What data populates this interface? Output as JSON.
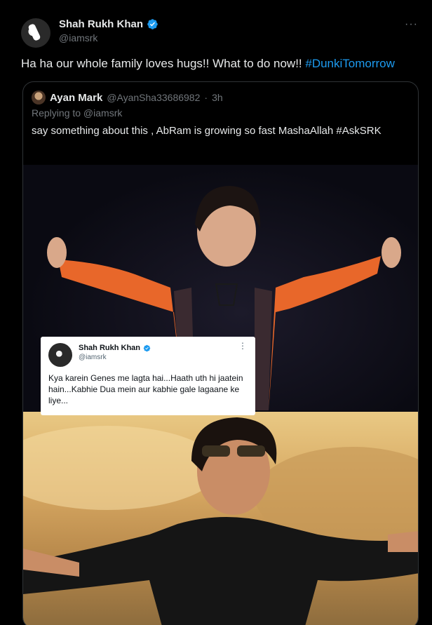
{
  "author": {
    "name": "Shah Rukh Khan",
    "handle": "@iamsrk",
    "more_icon": "more-horizontal-icon",
    "verified_color": "#1d9bf0"
  },
  "tweet": {
    "text": "Ha ha our whole family loves hugs!! What to do now!! ",
    "hashtag": "#DunkiTomorrow"
  },
  "quote": {
    "name": "Ayan Mark",
    "handle": "@AyanSha33686982",
    "separator": "·",
    "time": "3h",
    "replying_to": "Replying to @iamsrk",
    "text": "say something about this , AbRam is growing so fast MashaAllah #AskSRK"
  },
  "media": {
    "inner_tweet": {
      "name": "Shah Rukh Khan",
      "handle": "@iamsrk",
      "text": "Kya karein Genes me lagta hai...Haath uth hi jaatein hain...Kabhie Dua mein aur kabhie gale lagaane ke liye..."
    }
  },
  "colors": {
    "background": "#000000",
    "text": "#e7e9ea",
    "muted": "#71767b",
    "link": "#1d9bf0",
    "border": "#2f3336"
  }
}
